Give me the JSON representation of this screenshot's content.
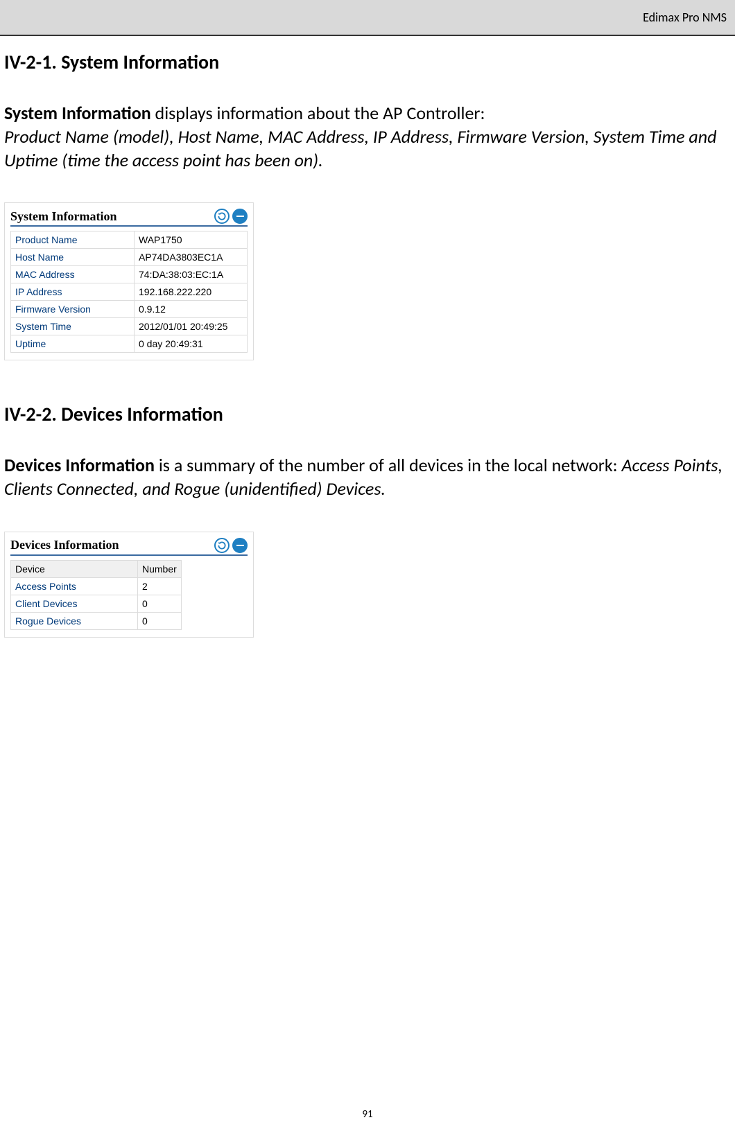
{
  "header": {
    "title": "Edimax Pro NMS"
  },
  "sections": {
    "sysinfo": {
      "heading": "IV-2-1. System Information",
      "intro_bold": "System Information",
      "intro_plain": " displays information about the AP Controller: ",
      "intro_italic": "Product Name (model), Host Name, MAC Address, IP Address, Firmware Version, System Time and Uptime (time the access point has been on).",
      "widget_title": "System Information",
      "rows": [
        {
          "label": "Product Name",
          "value": "WAP1750"
        },
        {
          "label": "Host Name",
          "value": "AP74DA3803EC1A"
        },
        {
          "label": "MAC Address",
          "value": "74:DA:38:03:EC:1A"
        },
        {
          "label": "IP Address",
          "value": "192.168.222.220"
        },
        {
          "label": "Firmware Version",
          "value": "0.9.12"
        },
        {
          "label": "System Time",
          "value": "2012/01/01 20:49:25"
        },
        {
          "label": "Uptime",
          "value": "0 day 20:49:31"
        }
      ]
    },
    "devinfo": {
      "heading": "IV-2-2. Devices Information",
      "intro_bold": "Devices Information",
      "intro_plain": " is a summary of the number of all devices in the local network: ",
      "intro_italic": "Access Points, Clients Connected, and Rogue (unidentified) Devices.",
      "widget_title": "Devices Information",
      "header_device": "Device",
      "header_number": "Number",
      "rows": [
        {
          "label": "Access Points",
          "value": "2"
        },
        {
          "label": "Client Devices",
          "value": "0"
        },
        {
          "label": "Rogue Devices",
          "value": "0"
        }
      ]
    }
  },
  "page_number": "91"
}
